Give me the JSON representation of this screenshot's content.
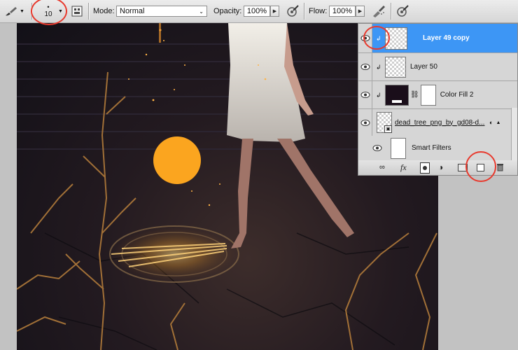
{
  "options_bar": {
    "brush_size": "10",
    "mode_label": "Mode:",
    "mode_value": "Normal",
    "opacity_label": "Opacity:",
    "opacity_value": "100%",
    "flow_label": "Flow:",
    "flow_value": "100%"
  },
  "layers_panel": {
    "layers": [
      {
        "name": "Layer 49 copy",
        "selected": true
      },
      {
        "name": "Layer 50",
        "selected": false
      },
      {
        "name": "Color Fill 2",
        "selected": false
      },
      {
        "name": "dead_tree_png_by_gd08-d...",
        "selected": false
      },
      {
        "name": "Smart Filters",
        "selected": false
      }
    ],
    "footer_icons": [
      "link-layers-icon",
      "fx-icon",
      "layer-mask-icon",
      "adjustment-layer-icon",
      "group-folder-icon",
      "new-layer-icon",
      "trash-icon"
    ]
  },
  "colors": {
    "selection": "#3d96f5",
    "highlight_circle": "#e8392d",
    "orange_dot": "#fba51f"
  }
}
